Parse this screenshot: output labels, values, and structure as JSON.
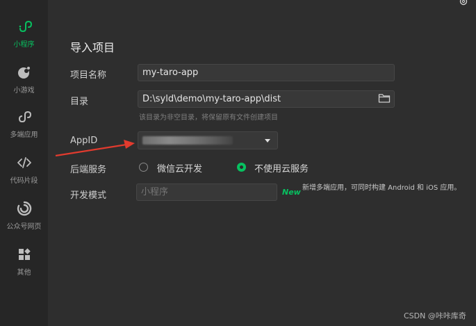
{
  "sidebar": {
    "items": [
      {
        "label": "小程序",
        "icon": "miniprogram-icon",
        "active": true
      },
      {
        "label": "小游戏",
        "icon": "minigame-icon"
      },
      {
        "label": "多端应用",
        "icon": "multi-platform-icon"
      },
      {
        "label": "代码片段",
        "icon": "code-icon"
      },
      {
        "label": "公众号网页",
        "icon": "official-account-icon"
      },
      {
        "label": "其他",
        "icon": "other-icon"
      }
    ]
  },
  "header": {
    "settings_icon": "gear-icon"
  },
  "form": {
    "title": "导入项目",
    "project_name": {
      "label": "项目名称",
      "value": "my-taro-app"
    },
    "directory": {
      "label": "目录",
      "value": "D:\\syld\\demo\\my-taro-app\\dist",
      "hint": "该目录为非空目录，将保留原有文件创建项目",
      "browse_icon": "folder-icon"
    },
    "appid": {
      "label": "AppID",
      "dropdown_icon": "caret-down-icon"
    },
    "backend": {
      "label": "后端服务",
      "options": [
        {
          "label": "微信云开发",
          "checked": false
        },
        {
          "label": "不使用云服务",
          "checked": true
        }
      ]
    },
    "dev_mode": {
      "label": "开发模式",
      "placeholder": "小程序",
      "badge": "New",
      "description": "新增多端应用，可同时构建 Android 和 iOS 应用。"
    }
  },
  "watermark": "CSDN @咔咔库奇",
  "colors": {
    "accent": "#07c160",
    "annotation_arrow": "#e23b2e",
    "background": "#2e2e2e",
    "sidebar": "#262626"
  }
}
